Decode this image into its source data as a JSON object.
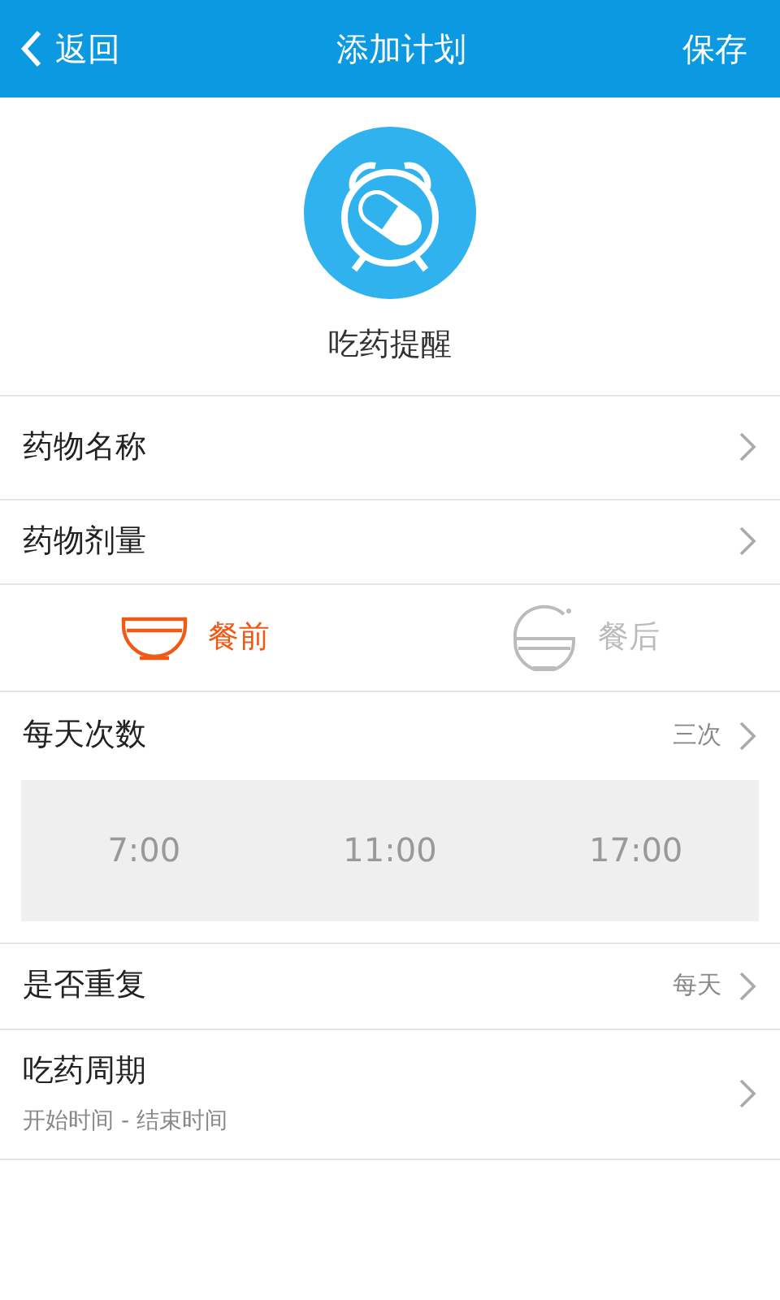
{
  "header": {
    "back": "返回",
    "title": "添加计划",
    "save": "保存"
  },
  "reminder": {
    "label": "吃药提醒"
  },
  "fields": [
    {
      "label": "药物名称"
    },
    {
      "label": "药物剂量"
    }
  ],
  "meal": [
    {
      "kind": "before",
      "label": "餐前",
      "selected": true
    },
    {
      "kind": "after",
      "label": "餐后",
      "selected": false
    }
  ],
  "frequency": {
    "label": "每天次数",
    "value": "三次",
    "times": [
      "7:00",
      "11:00",
      "17:00"
    ]
  },
  "repeat": {
    "label": "是否重复",
    "value": "每天"
  },
  "period": {
    "label": "吃药周期",
    "subtitle": "开始时间 - 结束时间"
  }
}
